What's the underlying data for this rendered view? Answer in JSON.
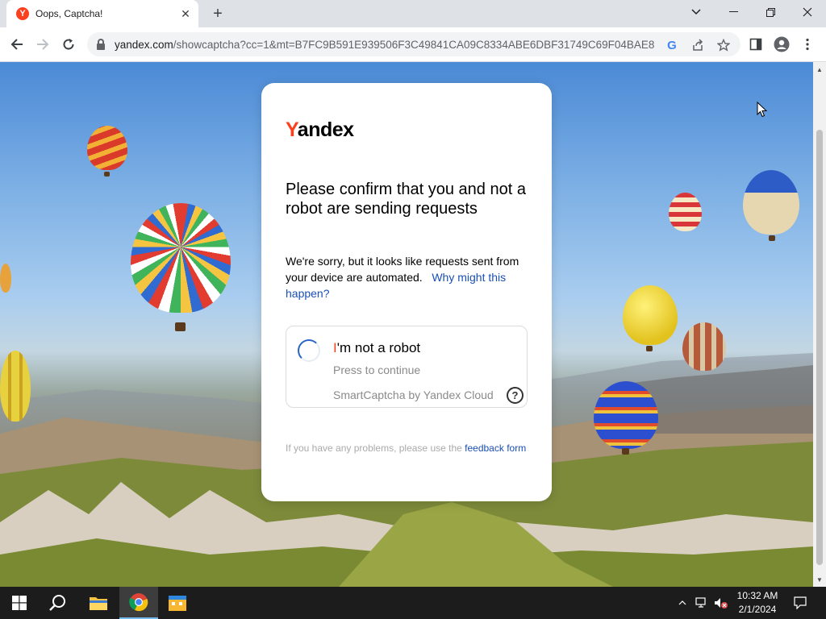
{
  "browser": {
    "tab": {
      "title": "Oops, Captcha!",
      "favicon_letter": "Y"
    },
    "url": {
      "host": "yandex.com",
      "path": "/showcaptcha?cc=1&mt=B7FC9B591E939506F3C49841CA09C8334ABE6DBF31749C69F04BAE8..."
    },
    "icons": {
      "back": "arrow-left-icon",
      "forward": "arrow-right-icon",
      "reload": "reload-icon",
      "lock": "lock-icon",
      "google": "google-icon",
      "share": "share-icon",
      "bookmark": "star-icon",
      "sidepanel": "side-panel-icon",
      "profile": "profile-icon",
      "menu": "kebab-menu-icon"
    }
  },
  "card": {
    "logo": {
      "first": "Y",
      "rest": "andex"
    },
    "heading": "Please confirm that you and not a robot are sending requests",
    "description": "We're sorry, but it looks like requests sent from your device are automated.",
    "why_link": "Why might this happen?",
    "captcha": {
      "title_first": "I",
      "title_rest": "'m not a robot",
      "subtitle": "Press to continue",
      "brand": "SmartCaptcha by Yandex Cloud",
      "help": "?"
    },
    "footnote": "If you have any problems, please use the",
    "feedback_link": "feedback form"
  },
  "taskbar": {
    "time": "10:32 AM",
    "date": "2/1/2024"
  },
  "colors": {
    "accent_red": "#fc3f1d",
    "link_blue": "#1a4fb4"
  }
}
